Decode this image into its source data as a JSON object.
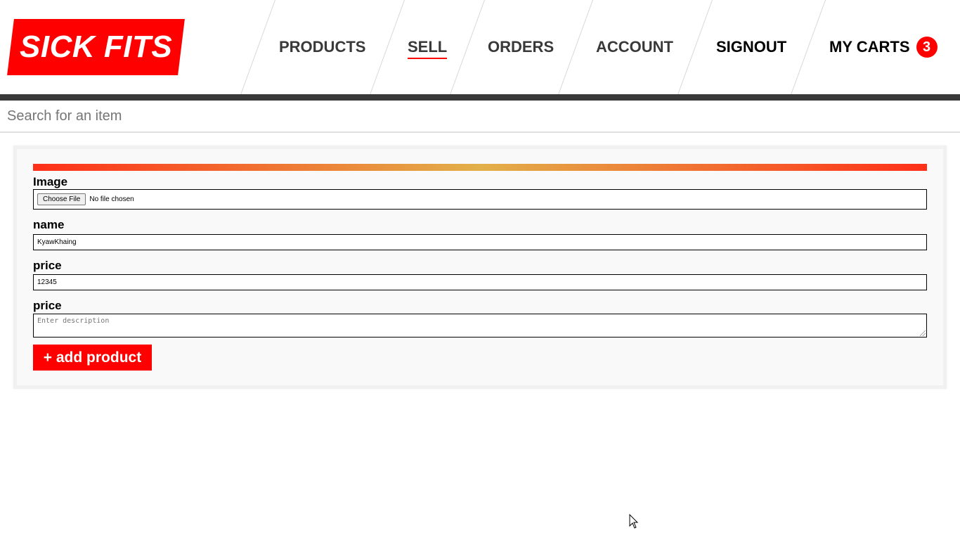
{
  "header": {
    "logo_text": "SICK FITS",
    "nav": [
      {
        "label": "PRODUCTS"
      },
      {
        "label": "SELL",
        "active": true
      },
      {
        "label": "ORDERS"
      },
      {
        "label": "ACCOUNT"
      },
      {
        "label": "SIGNOUT"
      },
      {
        "label": "MY CARTS"
      }
    ],
    "cart_count": "3"
  },
  "search": {
    "placeholder": "Search for an item"
  },
  "form": {
    "image_label": "Image",
    "file_button": "Choose File",
    "file_status": "No file chosen",
    "name_label": "name",
    "name_value": "KyawKhaing",
    "price_label": "price",
    "price_value": "12345",
    "description_label": "price",
    "description_placeholder": "Enter description",
    "submit_label": "+ add product"
  },
  "colors": {
    "brand": "#ff0000",
    "dark_bar": "#393939",
    "gradient": [
      "#ff3019",
      "#e2b04a",
      "#ff3019"
    ]
  }
}
